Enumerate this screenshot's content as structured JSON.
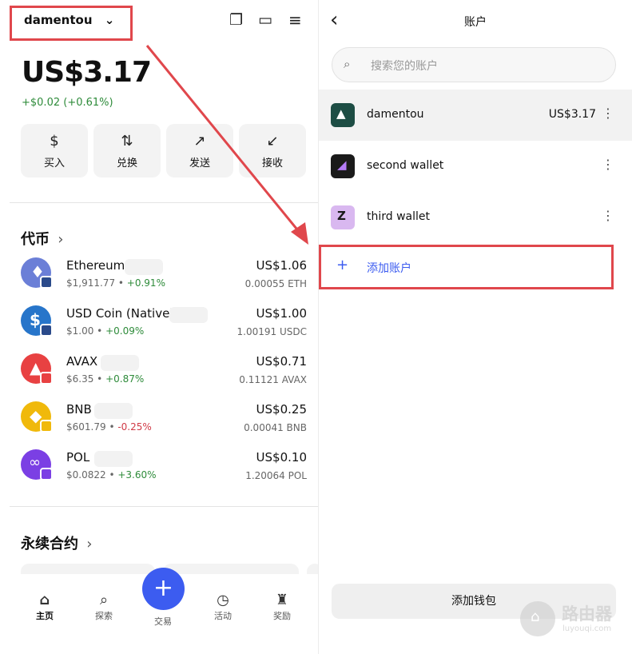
{
  "left": {
    "wallet_name": "damentou",
    "balance": "US$3.17",
    "change": "+$0.02 (+0.61%)",
    "actions": [
      {
        "icon": "$",
        "label": "买入"
      },
      {
        "icon": "⇅",
        "label": "兑换"
      },
      {
        "icon": "↗",
        "label": "发送"
      },
      {
        "icon": "↙",
        "label": "接收"
      }
    ],
    "tokens_title": "代币",
    "tokens": [
      {
        "name": "Ethereum",
        "price": "$1,911.77",
        "change": "+0.91%",
        "usd": "US$1.06",
        "amount": "0.00055 ETH"
      },
      {
        "name": "USD Coin (Native)",
        "price": "$1.00",
        "change": "+0.09%",
        "usd": "US$1.00",
        "amount": "1.00191 USDC"
      },
      {
        "name": "AVAX",
        "price": "$6.35",
        "change": "+0.87%",
        "usd": "US$0.71",
        "amount": "0.11121 AVAX"
      },
      {
        "name": "BNB",
        "price": "$601.79",
        "change": "-0.25%",
        "usd": "US$0.25",
        "amount": "0.00041 BNB"
      },
      {
        "name": "POL",
        "price": "$0.0822",
        "change": "+3.60%",
        "usd": "US$0.10",
        "amount": "1.20064 POL"
      }
    ],
    "perps_title": "永续合约",
    "nav": [
      {
        "icon": "⌂",
        "label": "主页"
      },
      {
        "icon": "⌕",
        "label": "探索"
      },
      {
        "icon": "+",
        "label": "交易"
      },
      {
        "icon": "◷",
        "label": "活动"
      },
      {
        "icon": "♜",
        "label": "奖励"
      }
    ]
  },
  "right": {
    "title": "账户",
    "search_placeholder": "搜索您的账户",
    "accounts": [
      {
        "name": "damentou",
        "balance": "US$3.17"
      },
      {
        "name": "second wallet",
        "balance": ""
      },
      {
        "name": "third wallet",
        "balance": ""
      }
    ],
    "add_account": "添加账户",
    "add_wallet": "添加钱包"
  },
  "watermark": {
    "brand": "路由器",
    "site": "luyouqi.com"
  },
  "colors": {
    "accent": "#3c5cf0",
    "positive": "#2e8b3a",
    "negative": "#d03a46",
    "highlight": "#e0474c"
  }
}
